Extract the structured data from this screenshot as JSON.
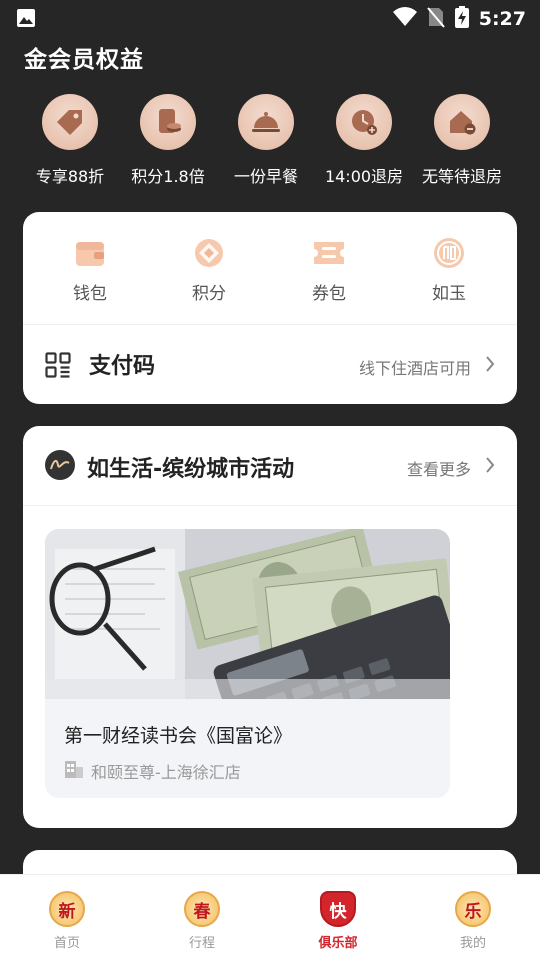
{
  "status_bar": {
    "time": "5:27"
  },
  "page": {
    "title": "金会员权益"
  },
  "benefits": [
    {
      "label": "专享88折",
      "icon": "discount-tag-icon"
    },
    {
      "label": "积分1.8倍",
      "icon": "points-card-icon"
    },
    {
      "label": "一份早餐",
      "icon": "breakfast-cloche-icon"
    },
    {
      "label": "14:00退房",
      "icon": "late-checkout-clock-icon"
    },
    {
      "label": "无等待退房",
      "icon": "express-checkout-house-icon"
    }
  ],
  "wallet": [
    {
      "label": "钱包",
      "icon": "wallet-icon"
    },
    {
      "label": "积分",
      "icon": "points-icon"
    },
    {
      "label": "券包",
      "icon": "coupon-icon"
    },
    {
      "label": "如玉",
      "icon": "ruyu-icon"
    }
  ],
  "paycode": {
    "title": "支付码",
    "hint": "线下住酒店可用"
  },
  "activity": {
    "title": "如生活-缤纷城市活动",
    "more": "查看更多",
    "event": {
      "title": "第一财经读书会《国富论》",
      "location": "和颐至尊-上海徐汇店"
    }
  },
  "nav": [
    {
      "label": "首页",
      "glyph": "新",
      "active": false
    },
    {
      "label": "行程",
      "glyph": "春",
      "active": false
    },
    {
      "label": "俱乐部",
      "glyph": "快",
      "active": true
    },
    {
      "label": "我的",
      "glyph": "乐",
      "active": false
    }
  ],
  "colors": {
    "background": "#262626",
    "accent": "#d4242c",
    "benefit_circle": "#e8c3b0",
    "wallet_icon": "#f0b89a"
  }
}
